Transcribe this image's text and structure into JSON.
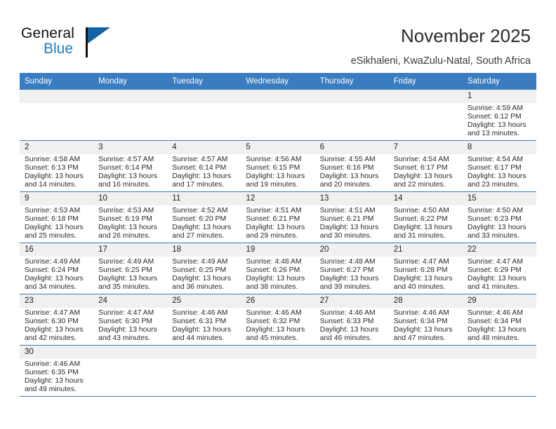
{
  "brand": {
    "name_part1": "General",
    "name_part2": "Blue",
    "accent_color": "#1c7fc4"
  },
  "header": {
    "title": "November 2025",
    "subtitle": "eSikhaleni, KwaZulu-Natal, South Africa",
    "header_bg_color": "#3a7cc0"
  },
  "calendar": {
    "weekday_headers": [
      "Sunday",
      "Monday",
      "Tuesday",
      "Wednesday",
      "Thursday",
      "Friday",
      "Saturday"
    ],
    "labels": {
      "sunrise": "Sunrise:",
      "sunset": "Sunset:",
      "daylight": "Daylight:"
    },
    "weeks": [
      [
        {
          "day": "",
          "empty": true
        },
        {
          "day": "",
          "empty": true
        },
        {
          "day": "",
          "empty": true
        },
        {
          "day": "",
          "empty": true
        },
        {
          "day": "",
          "empty": true
        },
        {
          "day": "",
          "empty": true
        },
        {
          "day": "1",
          "sunrise": "Sunrise: 4:59 AM",
          "sunset": "Sunset: 6:12 PM",
          "daylight": "Daylight: 13 hours and 13 minutes."
        }
      ],
      [
        {
          "day": "2",
          "sunrise": "Sunrise: 4:58 AM",
          "sunset": "Sunset: 6:13 PM",
          "daylight": "Daylight: 13 hours and 14 minutes."
        },
        {
          "day": "3",
          "sunrise": "Sunrise: 4:57 AM",
          "sunset": "Sunset: 6:14 PM",
          "daylight": "Daylight: 13 hours and 16 minutes."
        },
        {
          "day": "4",
          "sunrise": "Sunrise: 4:57 AM",
          "sunset": "Sunset: 6:14 PM",
          "daylight": "Daylight: 13 hours and 17 minutes."
        },
        {
          "day": "5",
          "sunrise": "Sunrise: 4:56 AM",
          "sunset": "Sunset: 6:15 PM",
          "daylight": "Daylight: 13 hours and 19 minutes."
        },
        {
          "day": "6",
          "sunrise": "Sunrise: 4:55 AM",
          "sunset": "Sunset: 6:16 PM",
          "daylight": "Daylight: 13 hours and 20 minutes."
        },
        {
          "day": "7",
          "sunrise": "Sunrise: 4:54 AM",
          "sunset": "Sunset: 6:17 PM",
          "daylight": "Daylight: 13 hours and 22 minutes."
        },
        {
          "day": "8",
          "sunrise": "Sunrise: 4:54 AM",
          "sunset": "Sunset: 6:17 PM",
          "daylight": "Daylight: 13 hours and 23 minutes."
        }
      ],
      [
        {
          "day": "9",
          "sunrise": "Sunrise: 4:53 AM",
          "sunset": "Sunset: 6:18 PM",
          "daylight": "Daylight: 13 hours and 25 minutes."
        },
        {
          "day": "10",
          "sunrise": "Sunrise: 4:53 AM",
          "sunset": "Sunset: 6:19 PM",
          "daylight": "Daylight: 13 hours and 26 minutes."
        },
        {
          "day": "11",
          "sunrise": "Sunrise: 4:52 AM",
          "sunset": "Sunset: 6:20 PM",
          "daylight": "Daylight: 13 hours and 27 minutes."
        },
        {
          "day": "12",
          "sunrise": "Sunrise: 4:51 AM",
          "sunset": "Sunset: 6:21 PM",
          "daylight": "Daylight: 13 hours and 29 minutes."
        },
        {
          "day": "13",
          "sunrise": "Sunrise: 4:51 AM",
          "sunset": "Sunset: 6:21 PM",
          "daylight": "Daylight: 13 hours and 30 minutes."
        },
        {
          "day": "14",
          "sunrise": "Sunrise: 4:50 AM",
          "sunset": "Sunset: 6:22 PM",
          "daylight": "Daylight: 13 hours and 31 minutes."
        },
        {
          "day": "15",
          "sunrise": "Sunrise: 4:50 AM",
          "sunset": "Sunset: 6:23 PM",
          "daylight": "Daylight: 13 hours and 33 minutes."
        }
      ],
      [
        {
          "day": "16",
          "sunrise": "Sunrise: 4:49 AM",
          "sunset": "Sunset: 6:24 PM",
          "daylight": "Daylight: 13 hours and 34 minutes."
        },
        {
          "day": "17",
          "sunrise": "Sunrise: 4:49 AM",
          "sunset": "Sunset: 6:25 PM",
          "daylight": "Daylight: 13 hours and 35 minutes."
        },
        {
          "day": "18",
          "sunrise": "Sunrise: 4:49 AM",
          "sunset": "Sunset: 6:25 PM",
          "daylight": "Daylight: 13 hours and 36 minutes."
        },
        {
          "day": "19",
          "sunrise": "Sunrise: 4:48 AM",
          "sunset": "Sunset: 6:26 PM",
          "daylight": "Daylight: 13 hours and 38 minutes."
        },
        {
          "day": "20",
          "sunrise": "Sunrise: 4:48 AM",
          "sunset": "Sunset: 6:27 PM",
          "daylight": "Daylight: 13 hours and 39 minutes."
        },
        {
          "day": "21",
          "sunrise": "Sunrise: 4:47 AM",
          "sunset": "Sunset: 6:28 PM",
          "daylight": "Daylight: 13 hours and 40 minutes."
        },
        {
          "day": "22",
          "sunrise": "Sunrise: 4:47 AM",
          "sunset": "Sunset: 6:29 PM",
          "daylight": "Daylight: 13 hours and 41 minutes."
        }
      ],
      [
        {
          "day": "23",
          "sunrise": "Sunrise: 4:47 AM",
          "sunset": "Sunset: 6:30 PM",
          "daylight": "Daylight: 13 hours and 42 minutes."
        },
        {
          "day": "24",
          "sunrise": "Sunrise: 4:47 AM",
          "sunset": "Sunset: 6:30 PM",
          "daylight": "Daylight: 13 hours and 43 minutes."
        },
        {
          "day": "25",
          "sunrise": "Sunrise: 4:46 AM",
          "sunset": "Sunset: 6:31 PM",
          "daylight": "Daylight: 13 hours and 44 minutes."
        },
        {
          "day": "26",
          "sunrise": "Sunrise: 4:46 AM",
          "sunset": "Sunset: 6:32 PM",
          "daylight": "Daylight: 13 hours and 45 minutes."
        },
        {
          "day": "27",
          "sunrise": "Sunrise: 4:46 AM",
          "sunset": "Sunset: 6:33 PM",
          "daylight": "Daylight: 13 hours and 46 minutes."
        },
        {
          "day": "28",
          "sunrise": "Sunrise: 4:46 AM",
          "sunset": "Sunset: 6:34 PM",
          "daylight": "Daylight: 13 hours and 47 minutes."
        },
        {
          "day": "29",
          "sunrise": "Sunrise: 4:46 AM",
          "sunset": "Sunset: 6:34 PM",
          "daylight": "Daylight: 13 hours and 48 minutes."
        }
      ],
      [
        {
          "day": "30",
          "sunrise": "Sunrise: 4:46 AM",
          "sunset": "Sunset: 6:35 PM",
          "daylight": "Daylight: 13 hours and 49 minutes."
        },
        {
          "day": "",
          "empty": true
        },
        {
          "day": "",
          "empty": true
        },
        {
          "day": "",
          "empty": true
        },
        {
          "day": "",
          "empty": true
        },
        {
          "day": "",
          "empty": true
        },
        {
          "day": "",
          "empty": true
        }
      ]
    ]
  }
}
